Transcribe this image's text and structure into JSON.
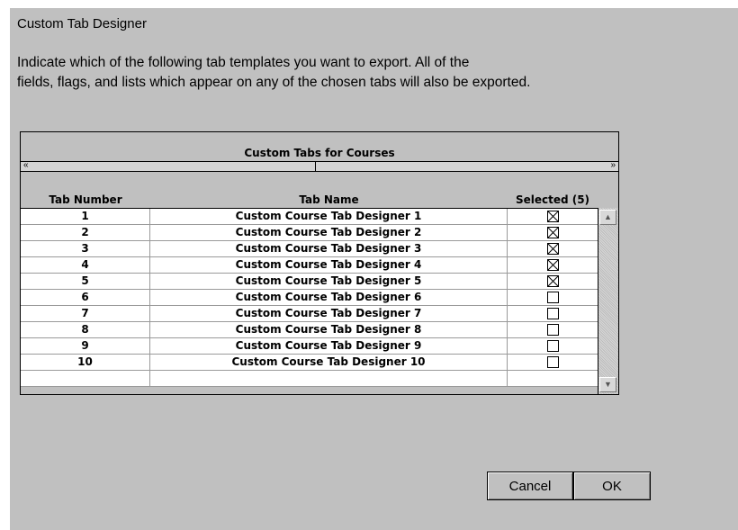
{
  "dialog": {
    "title": "Custom Tab Designer",
    "instructions_line1": "Indicate which of the following tab templates you want to export.  All of the",
    "instructions_line2": "fields, flags, and lists which appear on any of the chosen tabs will also be exported."
  },
  "grid": {
    "title": "Custom Tabs for Courses",
    "scroll_left_icon": "double-left-arrow",
    "scroll_right_icon": "double-right-arrow",
    "headers": {
      "tab_number": "Tab Number",
      "tab_name": "Tab Name",
      "selected": "Selected (5)"
    },
    "rows": [
      {
        "number": "1",
        "name": "Custom Course Tab Designer 1",
        "selected": true
      },
      {
        "number": "2",
        "name": "Custom Course Tab Designer 2",
        "selected": true
      },
      {
        "number": "3",
        "name": "Custom Course Tab Designer 3",
        "selected": true
      },
      {
        "number": "4",
        "name": "Custom Course Tab Designer 4",
        "selected": true
      },
      {
        "number": "5",
        "name": "Custom Course Tab Designer 5",
        "selected": true
      },
      {
        "number": "6",
        "name": "Custom Course Tab Designer 6",
        "selected": false
      },
      {
        "number": "7",
        "name": "Custom Course Tab Designer 7",
        "selected": false
      },
      {
        "number": "8",
        "name": "Custom Course Tab Designer 8",
        "selected": false
      },
      {
        "number": "9",
        "name": "Custom Course Tab Designer 9",
        "selected": false
      },
      {
        "number": "10",
        "name": "Custom Course Tab Designer 10",
        "selected": false
      },
      {
        "number": "",
        "name": "",
        "selected": null
      }
    ]
  },
  "buttons": {
    "cancel": "Cancel",
    "ok": "OK"
  }
}
